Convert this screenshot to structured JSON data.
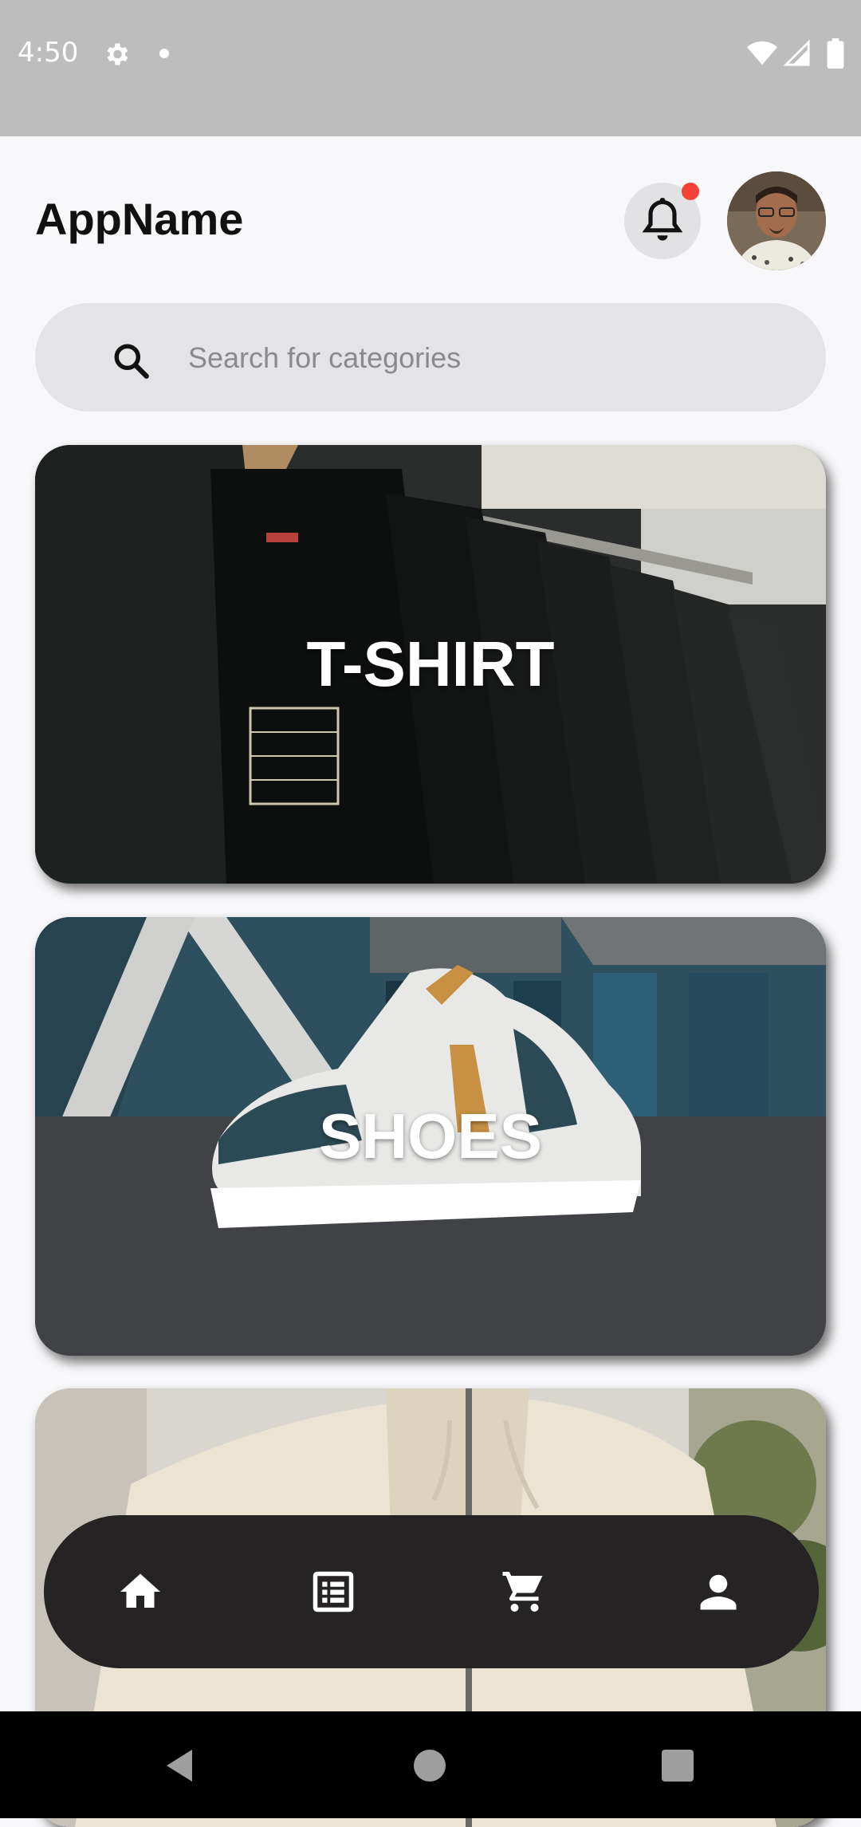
{
  "status_bar": {
    "time": "4:50",
    "icons": [
      "gear-icon",
      "dot-icon",
      "wifi-icon",
      "signal-icon",
      "battery-icon"
    ]
  },
  "header": {
    "title": "AppName",
    "notification_icon": "bell-icon",
    "notification_badge_color": "#f44336"
  },
  "search": {
    "icon": "search-icon",
    "placeholder": "Search for categories",
    "value": ""
  },
  "categories": [
    {
      "label": "T-SHIRT"
    },
    {
      "label": "SHOES"
    },
    {
      "label": ""
    }
  ],
  "bottom_nav": {
    "items": [
      {
        "icon": "home-icon"
      },
      {
        "icon": "list-icon"
      },
      {
        "icon": "cart-icon"
      },
      {
        "icon": "person-icon"
      }
    ],
    "background": "#262324"
  },
  "system_nav": {
    "items": [
      "back-icon",
      "home-circle-icon",
      "recents-icon"
    ]
  }
}
